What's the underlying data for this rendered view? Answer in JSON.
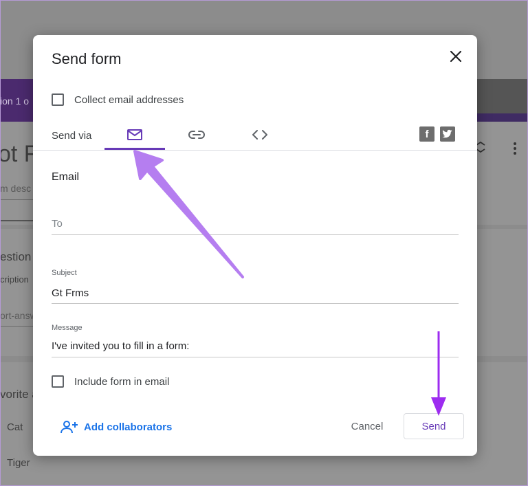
{
  "background": {
    "banner_text": "ion 1 o",
    "form_title": "ot Fr",
    "form_desc": "m desc",
    "question1": "estion",
    "question1_desc": "cription",
    "question1_answer": "ort-answ",
    "question2": "vorite a",
    "options": [
      "Cat",
      "Tiger"
    ]
  },
  "dialog": {
    "title": "Send form",
    "collect_email_label": "Collect email addresses",
    "send_via_label": "Send via",
    "tabs": [
      {
        "icon": "mail-icon",
        "active": true
      },
      {
        "icon": "link-icon",
        "active": false
      },
      {
        "icon": "embed-code-icon",
        "active": false
      }
    ],
    "social": [
      {
        "icon": "facebook-icon",
        "glyph": "f"
      },
      {
        "icon": "twitter-icon",
        "glyph": "t"
      }
    ],
    "email_section_title": "Email",
    "to_placeholder": "To",
    "subject_label": "Subject",
    "subject_value": "Gt Frms",
    "message_label": "Message",
    "message_value": "I've invited you to fill in a form:",
    "include_form_label": "Include form in email",
    "add_collaborators_label": "Add collaborators",
    "cancel_label": "Cancel",
    "send_label": "Send"
  },
  "colors": {
    "accent": "#673ab7",
    "link": "#1a73e8",
    "annotation_arrow": "#b57ef0",
    "annotation_arrow_dark": "#9d2cf0"
  }
}
